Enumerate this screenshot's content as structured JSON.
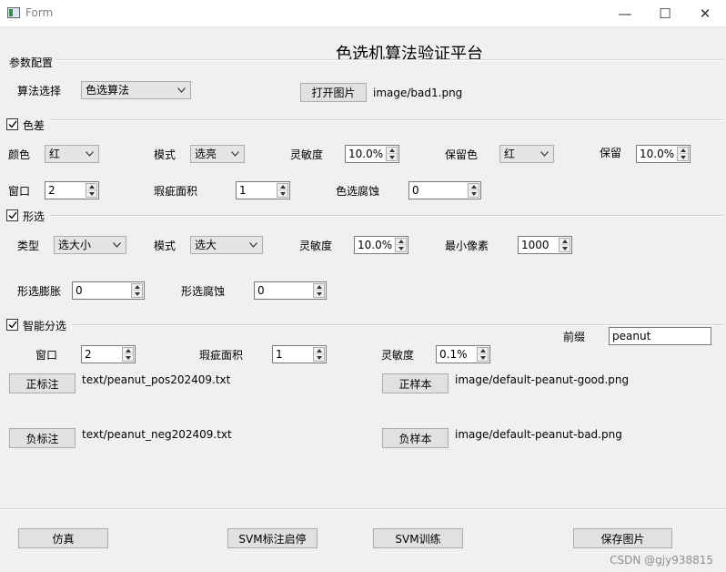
{
  "window": {
    "title": "Form",
    "minimize_glyph": "—",
    "maximize_glyph": "☐",
    "close_glyph": "✕"
  },
  "page_title": "色选机算法验证平台",
  "params": {
    "group_label": "参数配置",
    "algorithm_label": "算法选择",
    "algorithm_value": "色选算法",
    "open_image_button": "打开图片",
    "image_path": "image/bad1.png"
  },
  "color_diff": {
    "group_label": "色差",
    "checked": true,
    "color_label": "颜色",
    "color_value": "红",
    "mode_label": "模式",
    "mode_value": "选亮",
    "sensitivity_label": "灵敏度",
    "sensitivity_value": "10.0%",
    "keep_color_label": "保留色",
    "keep_color_value": "红",
    "keep_label": "保留",
    "keep_value": "10.0%",
    "window_label": "窗口",
    "window_value": "2",
    "defect_area_label": "瑕疵面积",
    "defect_area_value": "1",
    "erosion_label": "色选腐蚀",
    "erosion_value": "0"
  },
  "shape_sel": {
    "group_label": "形选",
    "checked": true,
    "type_label": "类型",
    "type_value": "选大小",
    "mode_label": "模式",
    "mode_value": "选大",
    "sensitivity_label": "灵敏度",
    "sensitivity_value": "10.0%",
    "min_pixel_label": "最小像素",
    "min_pixel_value": "1000",
    "dilate_label": "形选膨胀",
    "dilate_value": "0",
    "erode_label": "形选腐蚀",
    "erode_value": "0"
  },
  "smart": {
    "group_label": "智能分选",
    "checked": true,
    "prefix_label": "前缀",
    "prefix_value": "peanut",
    "window_label": "窗口",
    "window_value": "2",
    "defect_area_label": "瑕疵面积",
    "defect_area_value": "1",
    "sensitivity_label": "灵敏度",
    "sensitivity_value": "0.1%",
    "pos_label_button": "正标注",
    "pos_label_path": "text/peanut_pos202409.txt",
    "pos_sample_button": "正样本",
    "pos_sample_path": "image/default-peanut-good.png",
    "neg_label_button": "负标注",
    "neg_label_path": "text/peanut_neg202409.txt",
    "neg_sample_button": "负样本",
    "neg_sample_path": "image/default-peanut-bad.png"
  },
  "bottom": {
    "simulate_button": "仿真",
    "svm_label_button": "SVM标注启停",
    "svm_train_button": "SVM训练",
    "save_image_button": "保存图片"
  },
  "watermark": "CSDN @gjy938815",
  "icons": {
    "app": "app-icon",
    "combo_arrow": "chevron-down-icon",
    "spin_up": "spin-up-icon",
    "spin_down": "spin-down-icon",
    "check": "check-icon"
  }
}
